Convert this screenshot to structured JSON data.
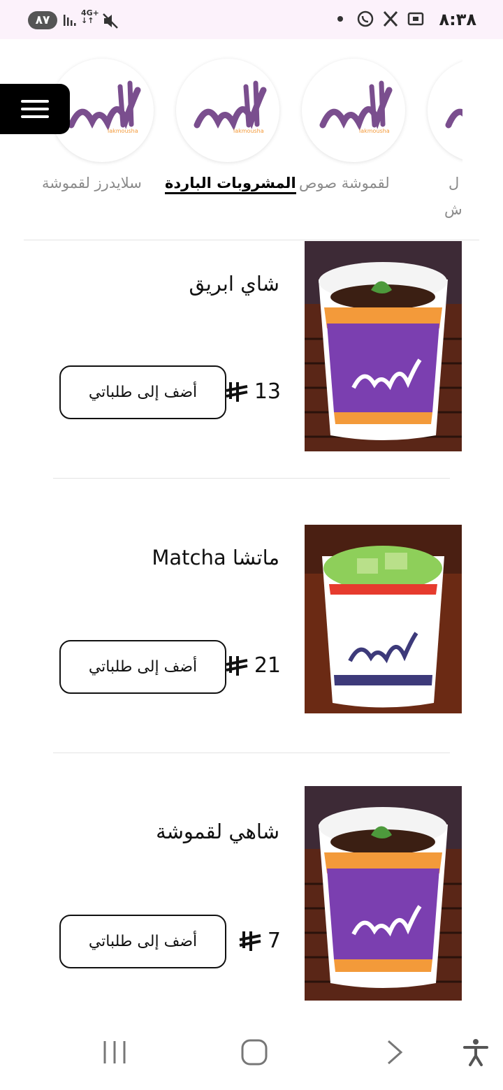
{
  "status_bar": {
    "time": "٨:٣٨",
    "battery": "٨٧",
    "network": "4G+"
  },
  "categories": [
    {
      "label": "سلايدرز لقموشة",
      "active": false
    },
    {
      "label": "المشروبات الباردة",
      "active": true
    },
    {
      "label": "لقموشة صوص",
      "active": false
    },
    {
      "label_line1": "ل",
      "label_line2": "ش",
      "active": false
    }
  ],
  "logo": {
    "arabic": "لقموشة",
    "latin": "lakmousha"
  },
  "colors": {
    "purple": "#7b3fb0",
    "orange": "#f39a3a",
    "accent_logo": "#7a4e8e"
  },
  "products": [
    {
      "name": "شاي ابريق",
      "price": "13",
      "add_label": "أضف إلى طلباتي",
      "image": "purple-cup-tea"
    },
    {
      "name": "ماتشا Matcha",
      "price": "21",
      "add_label": "أضف إلى طلباتي",
      "image": "white-cup-matcha"
    },
    {
      "name": "شاهي لقموشة",
      "price": "7",
      "add_label": "أضف إلى طلباتي",
      "image": "purple-cup-tea"
    }
  ]
}
